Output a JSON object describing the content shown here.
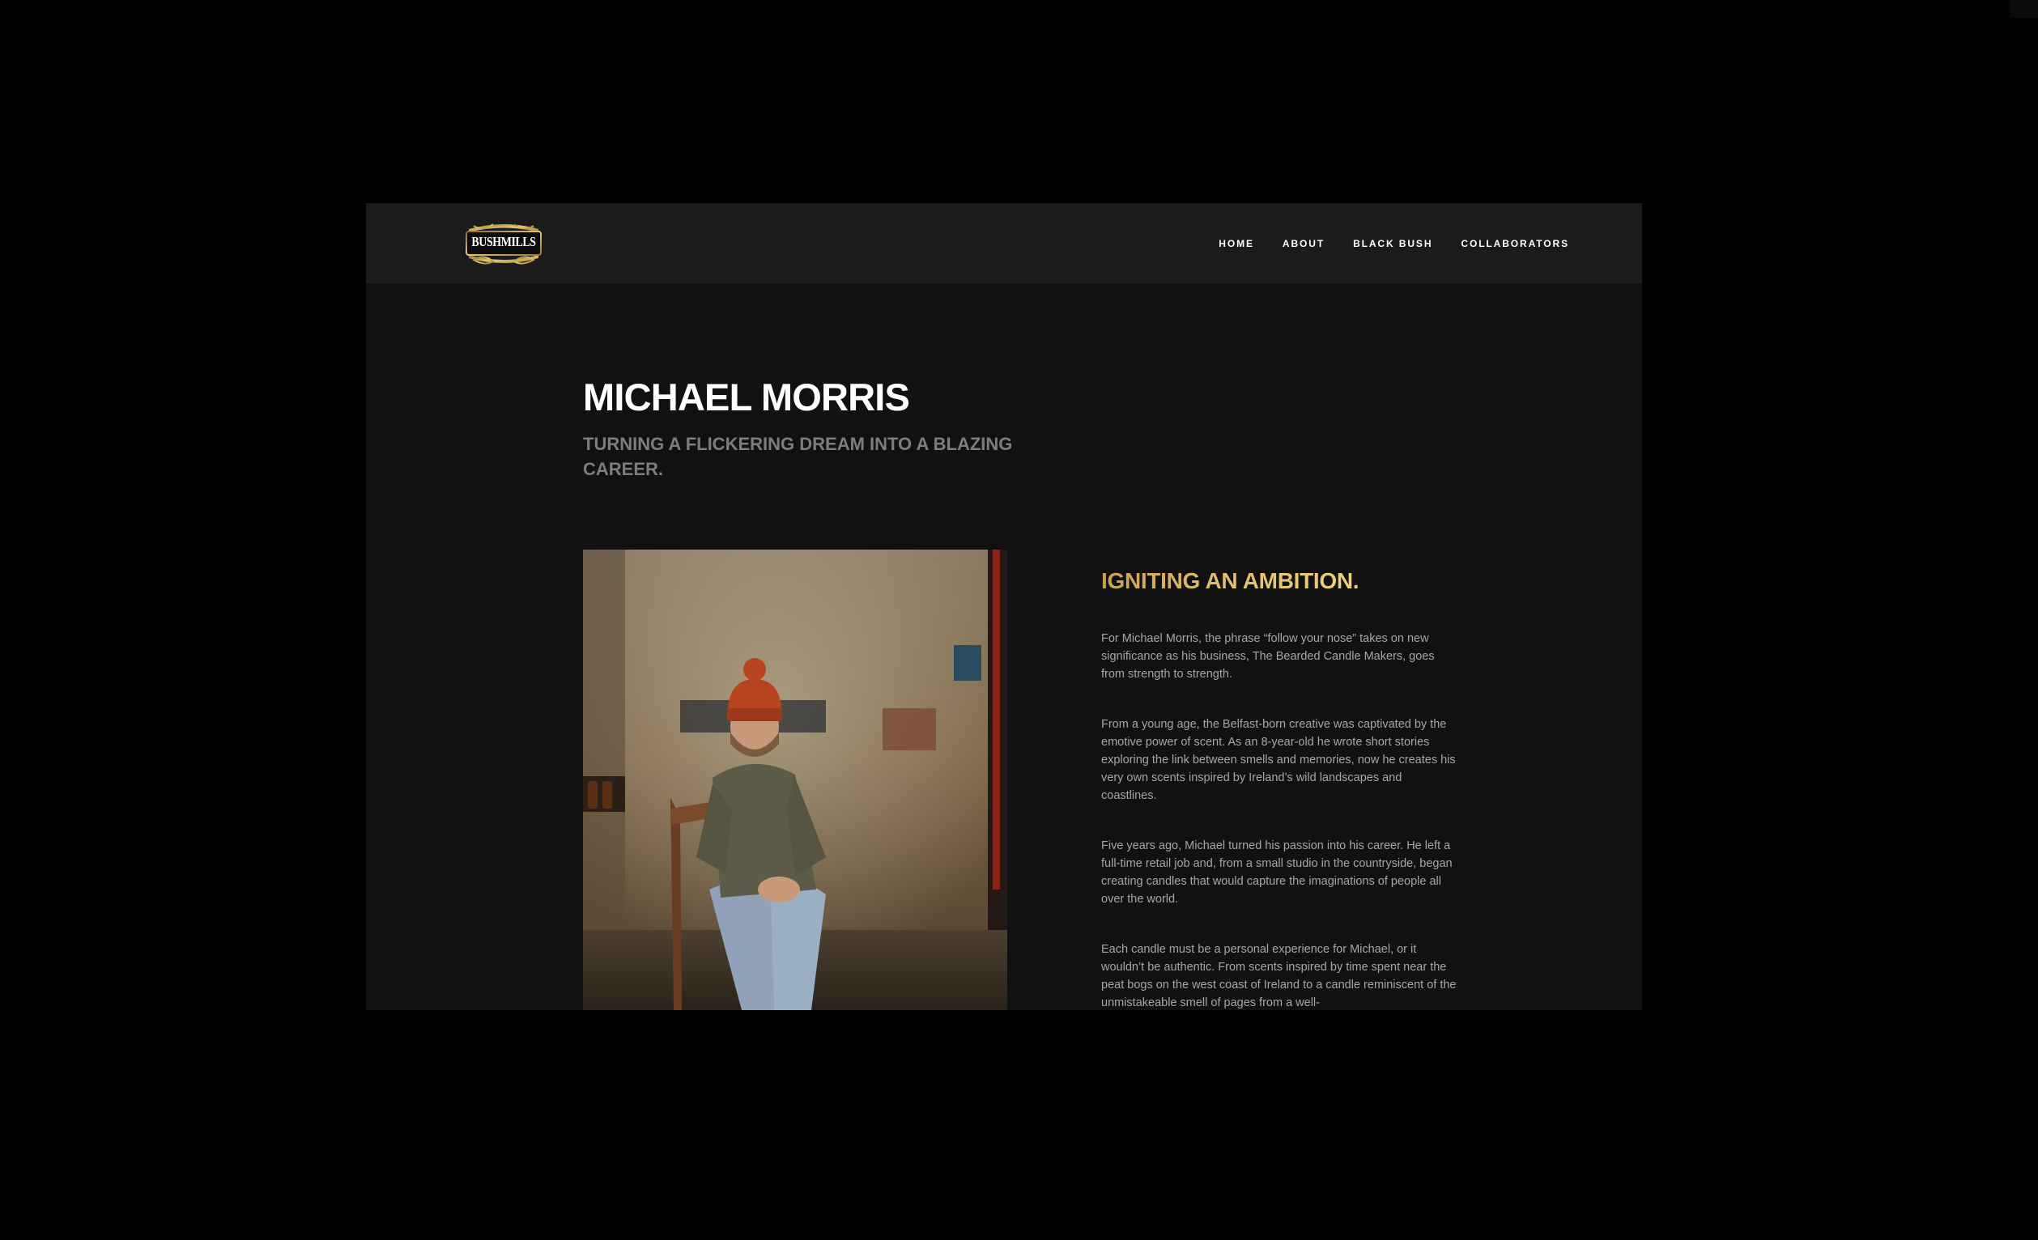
{
  "brand": {
    "logo_text": "BUSHMILLS",
    "logo_icon": "bushmills-logo-icon",
    "accent_gold": "#d9b25e"
  },
  "nav": {
    "items": [
      {
        "label": "HOME"
      },
      {
        "label": "ABOUT"
      },
      {
        "label": "BLACK BUSH"
      },
      {
        "label": "COLLABORATORS"
      }
    ]
  },
  "header": {
    "title": "MICHAEL MORRIS",
    "subtitle": "TURNING A FLICKERING DREAM INTO A BLAZING CAREER."
  },
  "photo": {
    "icon": "portrait-photo-icon"
  },
  "section": {
    "heading": "IGNITING AN AMBITION.",
    "paragraphs": [
      "For Michael Morris, the phrase “follow your nose” takes on new significance as his business, The Bearded Candle Makers, goes from strength to strength.",
      "From a young age, the Belfast-born creative was captivated by the emotive power of scent. As an 8-year-old he wrote short stories exploring the link between smells and memories, now he creates his very own scents inspired by Ireland’s wild landscapes and coastlines.",
      "Five years ago, Michael turned his passion into his career. He left a full-time retail job and, from a small studio in the countryside, began creating candles that would capture the imaginations of people all over the world.",
      "Each candle must be a personal experience for Michael, or it wouldn’t be authentic. From scents inspired by time spent near the peat bogs on the west coast of Ireland to a candle reminiscent of the unmistakeable smell of pages from a well-"
    ]
  }
}
